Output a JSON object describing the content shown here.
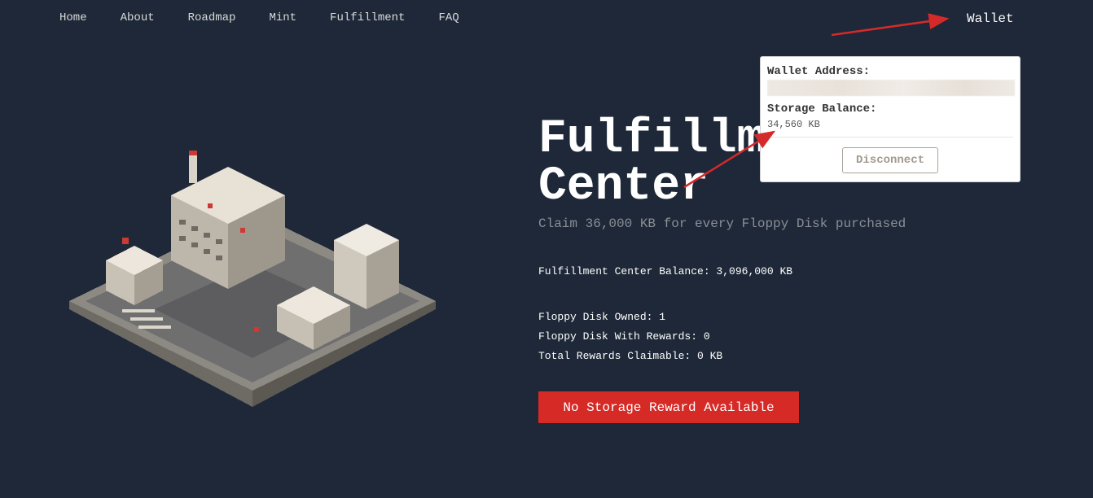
{
  "nav": {
    "items": [
      "Home",
      "About",
      "Roadmap",
      "Mint",
      "Fulfillment",
      "FAQ"
    ],
    "wallet_label": "Wallet"
  },
  "hero": {
    "title_line1": "Fulfillment",
    "title_line2": "Center",
    "subtitle": "Claim 36,000 KB for every Floppy Disk purchased"
  },
  "stats": {
    "center_balance": "Fulfillment Center Balance: 3,096,000 KB",
    "owned": "Floppy Disk Owned: 1",
    "with_rewards": "Floppy Disk With Rewards: 0",
    "claimable": "Total Rewards Claimable: 0 KB"
  },
  "claim_button": "No Storage Reward Available",
  "wallet_popup": {
    "address_label": "Wallet Address:",
    "balance_label": "Storage Balance:",
    "balance_value": "34,560 KB",
    "disconnect_label": "Disconnect"
  },
  "colors": {
    "background": "#1e2838",
    "accent_red": "#d62a26",
    "annotation_arrow": "#d42a2a"
  }
}
